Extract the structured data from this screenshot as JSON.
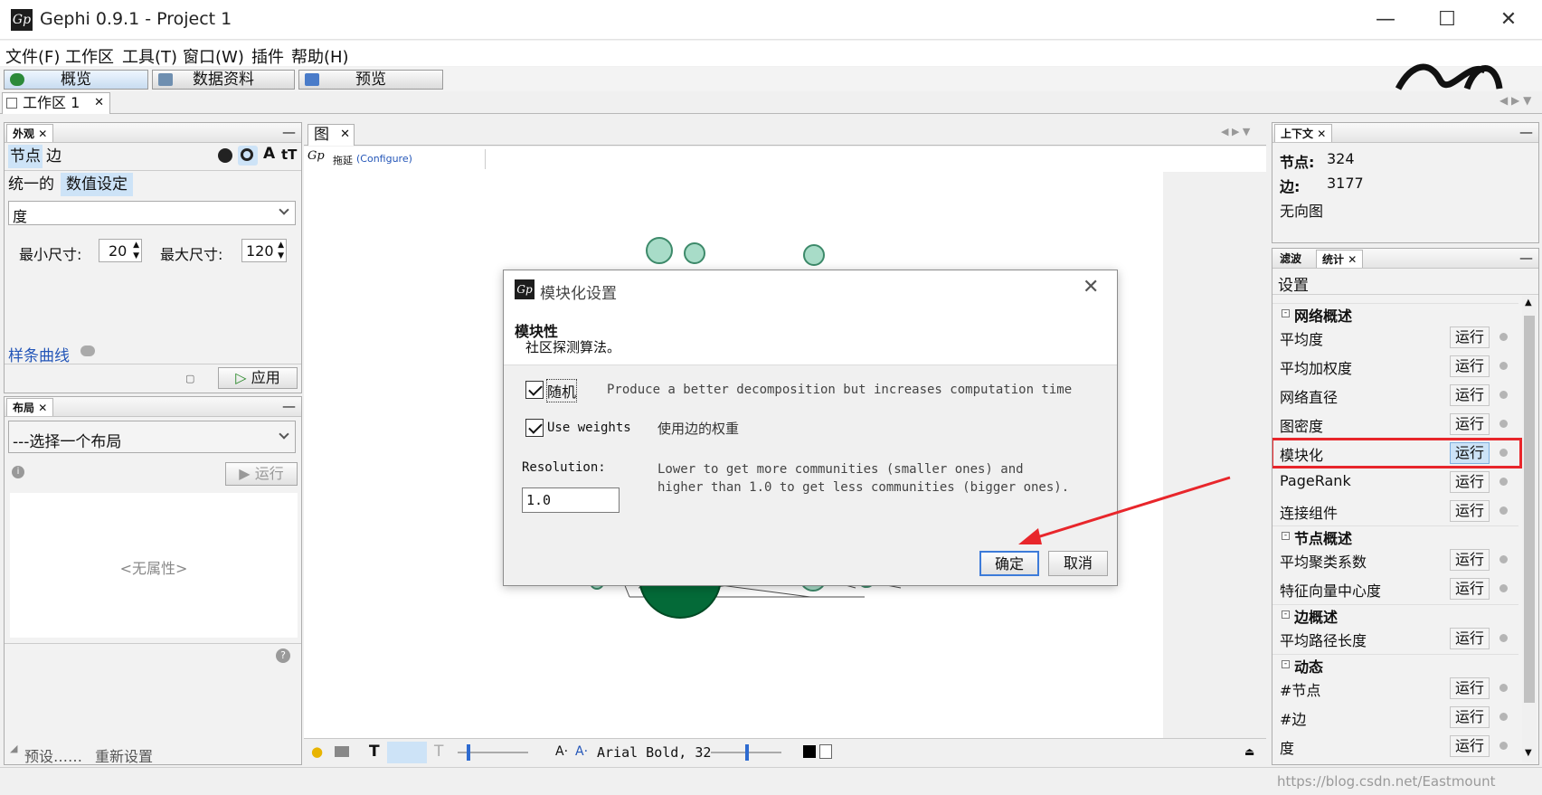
{
  "window": {
    "title": "Gephi 0.9.1 - Project 1",
    "logo": "Gp"
  },
  "menu": [
    "文件(F)",
    "工作区",
    "工具(T)",
    "窗口(W)",
    "插件",
    "帮助(H)"
  ],
  "perspectives": [
    "概览",
    "数据资料",
    "预览"
  ],
  "workspace_tab": "工作区 1",
  "appearance": {
    "title": "外观",
    "tab_nodes": "节点",
    "tab_edges": "边",
    "mode_unique": "统一的",
    "mode_ranking": "数值设定",
    "attribute": "度",
    "min_size_label": "最小尺寸:",
    "min_size": "20",
    "max_size_label": "最大尺寸:",
    "max_size": "120",
    "spline": "样条曲线",
    "apply": "应用"
  },
  "layout": {
    "title": "布局",
    "choose": "---选择一个布局",
    "run": "运行",
    "no_props": "<无属性>",
    "presets": "预设……",
    "reset": "重新设置"
  },
  "graph": {
    "tab": "图",
    "drag": "拖延",
    "configure": "(Configure)",
    "font_label": "Arial Bold, 32"
  },
  "context": {
    "title": "上下文",
    "nodes_label": "节点:",
    "nodes_value": "324",
    "edges_label": "边:",
    "edges_value": "3177",
    "graph_type": "无向图"
  },
  "statistics": {
    "tab_filter": "滤波",
    "tab_stats": "统计",
    "settings": "设置",
    "run_label": "运行",
    "network_header": "网络概述",
    "network": [
      "平均度",
      "平均加权度",
      "网络直径",
      "图密度",
      "模块化",
      "PageRank",
      "连接组件"
    ],
    "node_header": "节点概述",
    "node": [
      "平均聚类系数",
      "特征向量中心度"
    ],
    "edge_header": "边概述",
    "edge": [
      "平均路径长度"
    ],
    "dynamic_header": "动态",
    "dynamic": [
      "#节点",
      "#边",
      "度"
    ]
  },
  "dialog": {
    "title": "模块化设置",
    "heading": "模块性",
    "subheading": "社区探测算法。",
    "randomize_label": "随机",
    "randomize_desc": "Produce a better decomposition but increases computation time",
    "weights_label": "Use weights",
    "weights_desc": "使用边的权重",
    "resolution_label": "Resolution:",
    "resolution_value": "1.0",
    "resolution_desc_1": "Lower to get more communities (smaller ones) and",
    "resolution_desc_2": "higher than 1.0 to get less communities (bigger ones).",
    "ok": "确定",
    "cancel": "取消"
  },
  "watermark": "https://blog.csdn.net/Eastmount",
  "colors": {
    "highlight": "#e8262b",
    "accent": "#cde3f7",
    "node": "#a8dcc8",
    "node_dark": "#046a38"
  }
}
